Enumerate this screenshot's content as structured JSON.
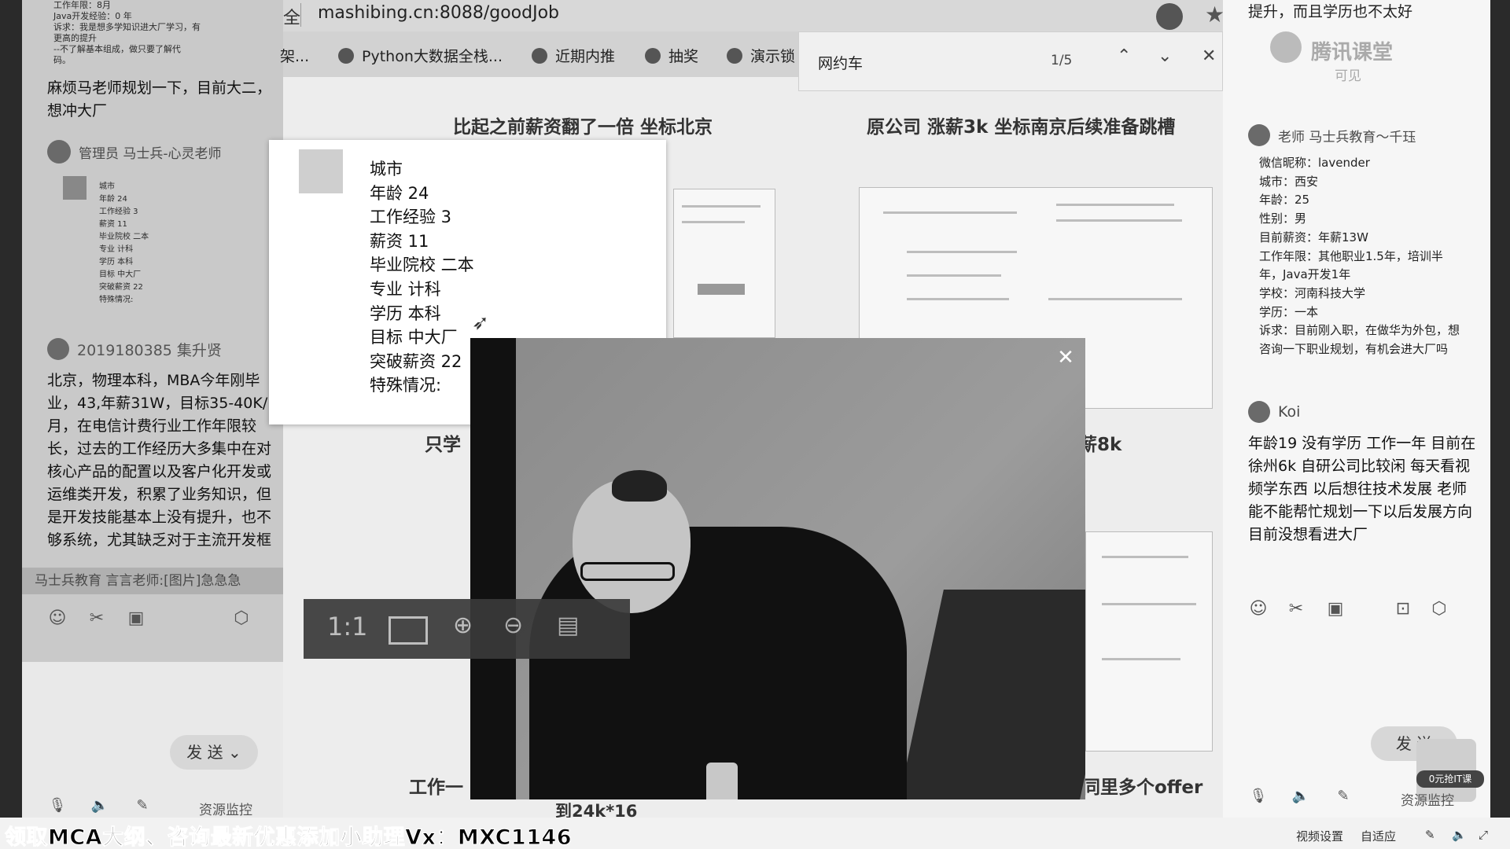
{
  "browser": {
    "url": "mashibing.cn:8088/goodJob",
    "url_prefix": "全",
    "bookmarks": [
      "架...",
      "Python大数据全栈...",
      "近期内推",
      "抽奖",
      "演示锁"
    ],
    "find": {
      "query": "网约车",
      "count": "1/5"
    }
  },
  "page": {
    "titles": [
      "比起之前薪资翻了一倍 坐标北京",
      "原公司 涨薪3k 坐标南京后续准备跳槽",
      "只学",
      "薪8k",
      "工作一",
      "到24k*16",
      "同里多个offer"
    ]
  },
  "left_chat": {
    "top_tiny": [
      "工作年限：8月",
      "Java开发经验：0 年",
      "诉求：我是想多学知识进大厂学习，有",
      "更高的提升",
      "--不了解基本组成，做只要了解代",
      "码。"
    ],
    "msg1": "麻烦马老师规划一下，目前大二，想冲大厂",
    "admin_name": "管理员  马士兵-心灵老师",
    "admin_tiny": [
      "城市",
      "年龄 24",
      "工作经验 3",
      "薪资 11",
      "毕业院校 二本",
      "专业 计科",
      "学历 本科",
      "目标 中大厂",
      "突破薪资 22",
      "特殊情况:"
    ],
    "user2": "2019180385 集升贤",
    "msg2": "北京，物理本科，MBA今年刚毕业，43,年薪31W，目标35-40K/月，在电信计费行业工作年限较长，过去的工作经历大多集中在对核心产品的配置以及客户化开发或运维类开发，积累了业务知识，但是开发技能基本上没有提升，也不够系统，尤其缺乏对于主流开发框",
    "notice": "马士兵教育  言言老师:[图片]急急急",
    "send": "发 送",
    "resource": "资源监控"
  },
  "card": {
    "lines": [
      "城市",
      "年龄 24",
      "工作经验 3",
      "薪资 11",
      "毕业院校 二本",
      "专业 计科",
      "学历 本科",
      "目标 中大厂",
      "突破薪资 22",
      "特殊情况:"
    ]
  },
  "zoombar": {
    "ratio": "1:1"
  },
  "right_chat": {
    "top_text": "提升，而且学历也不太好",
    "logo_text": "腾讯课堂",
    "logo_sub": "可见",
    "teacher": "老师  马士兵教育～千珏",
    "info": [
      "微信昵称：lavender",
      "城市：西安",
      "年龄：25",
      "性别：男",
      "目前薪资：年薪13W",
      "工作年限：其他职业1.5年，培训半年，Java开发1年",
      "学校：河南科技大学",
      "学历：一本",
      "诉求：目前刚入职，在做华为外包，想咨询一下职业规划，有机会进大厂吗"
    ],
    "user": "Koi",
    "msg": "年龄19 没有学历 工作一年 目前在徐州6k 自研公司比较闲 每天看视频学东西 以后想往技术发展 老师能不能帮忙规划一下以后发展方向 目前没想看进大厂",
    "send": "发 送",
    "resource": "资源监控",
    "promo": "0元抢IT课"
  },
  "banner": {
    "text": "领取MCA大纲、咨询最新优惠添加小助理Vx：MXC1146",
    "status": [
      "视频设置",
      "自适应"
    ]
  }
}
